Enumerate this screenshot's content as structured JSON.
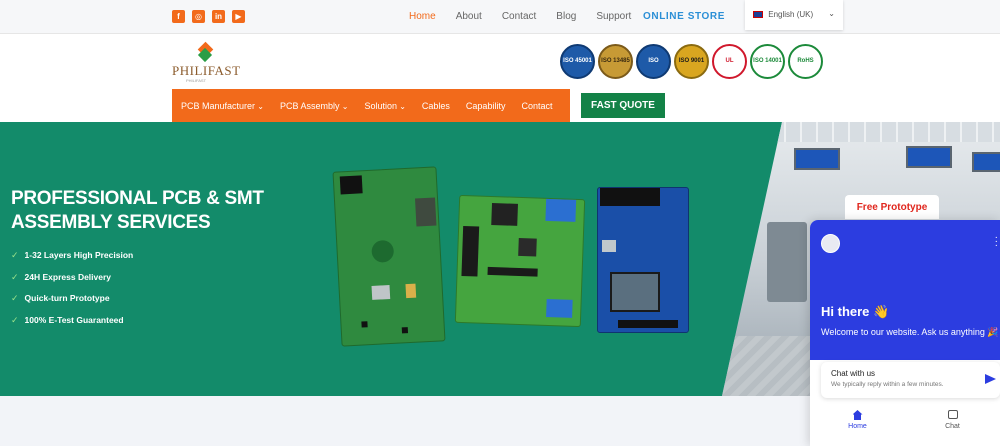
{
  "topbar": {
    "social": [
      {
        "icon": "facebook-icon",
        "glyph": "f"
      },
      {
        "icon": "instagram-icon",
        "glyph": "◎"
      },
      {
        "icon": "linkedin-icon",
        "glyph": "in"
      },
      {
        "icon": "youtube-icon",
        "glyph": "▶"
      }
    ],
    "nav": [
      "Home",
      "About",
      "Contact",
      "Blog",
      "Support"
    ],
    "online_store": "ONLINE STORE",
    "language": "English (UK)"
  },
  "header": {
    "logo_text": "PHILIFAST",
    "logo_sub": "PHILIFAST",
    "certs": [
      {
        "label": "ISO 45001",
        "bg": "#1e5aa8",
        "fg": "#ffffff",
        "ring": "#0f3a73"
      },
      {
        "label": "ISO 13485",
        "bg": "#c79a35",
        "fg": "#3a2a10",
        "ring": "#7b5a1a"
      },
      {
        "label": "ISO",
        "bg": "#1e5aa8",
        "fg": "#ffffff",
        "ring": "#0f3a73"
      },
      {
        "label": "ISO 9001",
        "bg": "#d9a620",
        "fg": "#1a1a1a",
        "ring": "#8a6a10"
      },
      {
        "label": "UL",
        "bg": "#ffffff",
        "fg": "#d0182c",
        "ring": "#d0182c"
      },
      {
        "label": "ISO 14001",
        "bg": "#ffffff",
        "fg": "#1c8a3a",
        "ring": "#1c8a3a"
      },
      {
        "label": "RoHS",
        "bg": "#ffffff",
        "fg": "#1c8a3a",
        "ring": "#1c8a3a"
      }
    ],
    "main_nav": [
      {
        "label": "PCB Manufacturer",
        "caret": true
      },
      {
        "label": "PCB Assembly",
        "caret": true
      },
      {
        "label": "Solution",
        "caret": true
      },
      {
        "label": "Cables",
        "caret": false
      },
      {
        "label": "Capability",
        "caret": false
      },
      {
        "label": "Contact",
        "caret": false
      }
    ],
    "fast_quote": "FAST QUOTE"
  },
  "hero": {
    "title_line1": "PROFESSIONAL PCB & SMT",
    "title_line2": "ASSEMBLY SERVICES",
    "features": [
      "1-32 Layers High Precision",
      "24H Express Delivery",
      "Quick-turn Prototype",
      "100% E-Test Guaranteed"
    ],
    "free_prototype": "Free Prototype"
  },
  "chat": {
    "greeting": "Hi there 👋",
    "welcome": "Welcome to our website. Ask us anything 🎉",
    "card_title": "Chat with us",
    "card_sub": "We typically reply within a few minutes.",
    "tabs": [
      "Home",
      "Chat"
    ]
  },
  "colors": {
    "accent": "#f26a1b",
    "hero_green": "#138b6a",
    "quote_green": "#138247",
    "chat_blue": "#2c3de0"
  }
}
